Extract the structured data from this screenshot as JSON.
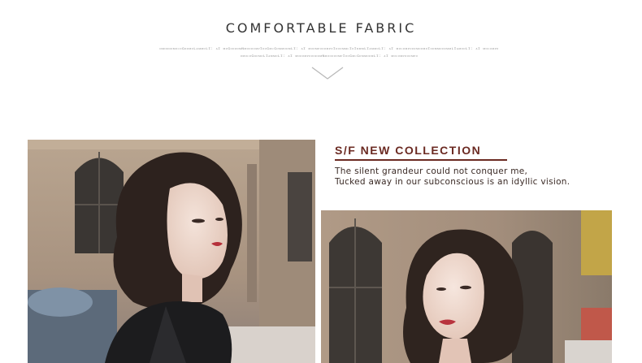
{
  "header": {
    "title": "COMFORTABLE FABRIC",
    "subline_1": "ᴅᴍᴏᴇᴅᴏᴍᴏᴄᴏɢᴅᴏᴍᴏʟᴀᴍᴍᴏʟɪ:  ᴀɪ  ᴍᴏɢᴏᴏᴇᴅᴍɴᴍᴏᴏᴏᴏᴍᴘɪᴏᴏɢᴍᴄɢᴏᴍᴍᴏᴏᴍʟɪ:  ᴀɪ  ᴍᴏᴏᴍᴘᴏᴏᴏᴍᴘᴏɪᴏᴏᴏᴍᴍᴄɪᴏɪᴅᴍᴍʟɪᴀᴍᴍᴏʟɪ:  ᴀɪ  ᴍᴏᴄᴏᴍᴘᴏᴏᴇᴍᴏᴏᴍᴏɪᴏᴏᴍᴍᴏᴏᴇᴍᴍʟɪᴀᴍᴏᴏʟɪ:  ᴀɪ  ᴍᴏᴄᴏᴍᴘᴏ",
    "subline_2": "ᴏᴍᴏᴄᴏɢᴅᴏᴍᴏʟɪᴀᴍᴍᴏʟɪ:  ᴀɪ  ᴍᴏᴏᴏᴍᴘᴏᴏᴏᴇᴅᴍɴᴍᴏᴏᴏᴏᴏᴍᴘɪᴏᴏɢᴍᴄɢᴏᴍᴍᴏᴏᴍʟɪ:  ᴀɪ  ᴍᴏᴄᴏᴍᴘᴏᴏᴏᴍᴘᴏ"
  },
  "collection": {
    "title": "S/F NEW COLLECTION",
    "line_1": "The silent grandeur could not conquer me,",
    "line_2": "Tucked away in our subconscious is an idyllic vision."
  },
  "colors": {
    "accent": "#6b2a22",
    "title_text": "#333333",
    "chevron": "#b8b8b8"
  }
}
